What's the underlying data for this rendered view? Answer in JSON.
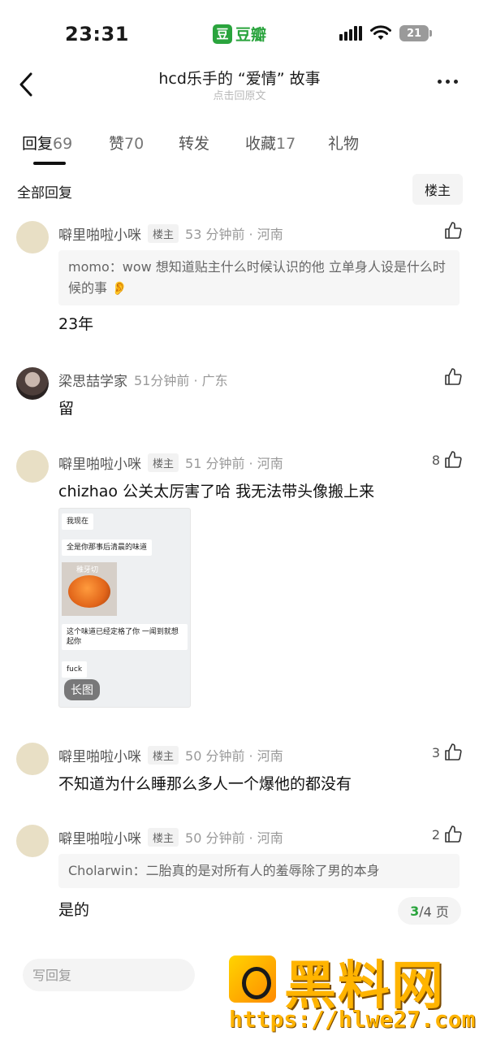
{
  "status_bar": {
    "time": "23:31",
    "app_logo_char": "豆",
    "app_name": "豆瓣",
    "battery": "21"
  },
  "header": {
    "title": "hcd乐手的 “爱情” 故事",
    "subtitle": "点击回原文"
  },
  "tabs": [
    {
      "label": "回复",
      "count": "69",
      "active": true
    },
    {
      "label": "赞",
      "count": "70"
    },
    {
      "label": "转发",
      "count": ""
    },
    {
      "label": "收藏",
      "count": "17"
    },
    {
      "label": "礼物",
      "count": ""
    }
  ],
  "section": {
    "title": "全部回复",
    "filter_label": "楼主"
  },
  "comments": [
    {
      "user": "噼里啪啦小咪",
      "tag": "楼主",
      "time": "53 分钟前 · 河南",
      "likes": "",
      "quote": "momo：wow 想知道贴主什么时候认识的他 立单身人设是什么时候的事 👂",
      "text": "23年"
    },
    {
      "user": "梁思喆学家",
      "tag": "",
      "time": "51分钟前 · 广东",
      "likes": "",
      "text": "留"
    },
    {
      "user": "噼里啪啦小咪",
      "tag": "楼主",
      "time": "51 分钟前 · 河南",
      "likes": "8",
      "text": "chizhao 公关太厉害了哈 我无法带头像搬上来",
      "image": {
        "bubbles": [
          "我现在",
          "全是你那事后清晨的味道",
          "这个味道已经定格了你 一闻到就想起你",
          "fuck"
        ],
        "caption": "稚牙切",
        "badge": "长图"
      }
    },
    {
      "user": "噼里啪啦小咪",
      "tag": "楼主",
      "time": "50 分钟前 · 河南",
      "likes": "3",
      "text": "不知道为什么睡那么多人一个爆他的都没有"
    },
    {
      "user": "噼里啪啦小咪",
      "tag": "楼主",
      "time": "50 分钟前 · 河南",
      "likes": "2",
      "quote": "Cholarwin：二胎真的是对所有人的羞辱除了男的本身",
      "text": "是的"
    }
  ],
  "pager": {
    "current": "3",
    "separator": "/",
    "total": "4 页"
  },
  "bottom": {
    "reply_placeholder": "写回复"
  },
  "watermark": {
    "text": "黑料网",
    "url": "https://hlwe27.com"
  },
  "colors": {
    "accent_green": "#2aa43d",
    "watermark_yellow": "#ffb400"
  }
}
